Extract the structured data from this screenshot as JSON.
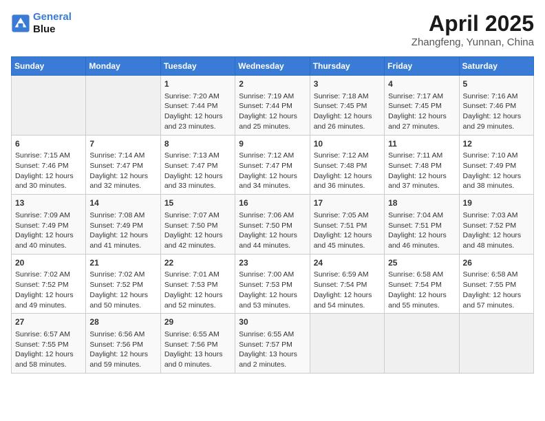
{
  "header": {
    "logo_line1": "General",
    "logo_line2": "Blue",
    "month_title": "April 2025",
    "location": "Zhangfeng, Yunnan, China"
  },
  "days_of_week": [
    "Sunday",
    "Monday",
    "Tuesday",
    "Wednesday",
    "Thursday",
    "Friday",
    "Saturday"
  ],
  "weeks": [
    [
      {
        "day": "",
        "content": ""
      },
      {
        "day": "",
        "content": ""
      },
      {
        "day": "1",
        "content": "Sunrise: 7:20 AM\nSunset: 7:44 PM\nDaylight: 12 hours and 23 minutes."
      },
      {
        "day": "2",
        "content": "Sunrise: 7:19 AM\nSunset: 7:44 PM\nDaylight: 12 hours and 25 minutes."
      },
      {
        "day": "3",
        "content": "Sunrise: 7:18 AM\nSunset: 7:45 PM\nDaylight: 12 hours and 26 minutes."
      },
      {
        "day": "4",
        "content": "Sunrise: 7:17 AM\nSunset: 7:45 PM\nDaylight: 12 hours and 27 minutes."
      },
      {
        "day": "5",
        "content": "Sunrise: 7:16 AM\nSunset: 7:46 PM\nDaylight: 12 hours and 29 minutes."
      }
    ],
    [
      {
        "day": "6",
        "content": "Sunrise: 7:15 AM\nSunset: 7:46 PM\nDaylight: 12 hours and 30 minutes."
      },
      {
        "day": "7",
        "content": "Sunrise: 7:14 AM\nSunset: 7:47 PM\nDaylight: 12 hours and 32 minutes."
      },
      {
        "day": "8",
        "content": "Sunrise: 7:13 AM\nSunset: 7:47 PM\nDaylight: 12 hours and 33 minutes."
      },
      {
        "day": "9",
        "content": "Sunrise: 7:12 AM\nSunset: 7:47 PM\nDaylight: 12 hours and 34 minutes."
      },
      {
        "day": "10",
        "content": "Sunrise: 7:12 AM\nSunset: 7:48 PM\nDaylight: 12 hours and 36 minutes."
      },
      {
        "day": "11",
        "content": "Sunrise: 7:11 AM\nSunset: 7:48 PM\nDaylight: 12 hours and 37 minutes."
      },
      {
        "day": "12",
        "content": "Sunrise: 7:10 AM\nSunset: 7:49 PM\nDaylight: 12 hours and 38 minutes."
      }
    ],
    [
      {
        "day": "13",
        "content": "Sunrise: 7:09 AM\nSunset: 7:49 PM\nDaylight: 12 hours and 40 minutes."
      },
      {
        "day": "14",
        "content": "Sunrise: 7:08 AM\nSunset: 7:49 PM\nDaylight: 12 hours and 41 minutes."
      },
      {
        "day": "15",
        "content": "Sunrise: 7:07 AM\nSunset: 7:50 PM\nDaylight: 12 hours and 42 minutes."
      },
      {
        "day": "16",
        "content": "Sunrise: 7:06 AM\nSunset: 7:50 PM\nDaylight: 12 hours and 44 minutes."
      },
      {
        "day": "17",
        "content": "Sunrise: 7:05 AM\nSunset: 7:51 PM\nDaylight: 12 hours and 45 minutes."
      },
      {
        "day": "18",
        "content": "Sunrise: 7:04 AM\nSunset: 7:51 PM\nDaylight: 12 hours and 46 minutes."
      },
      {
        "day": "19",
        "content": "Sunrise: 7:03 AM\nSunset: 7:52 PM\nDaylight: 12 hours and 48 minutes."
      }
    ],
    [
      {
        "day": "20",
        "content": "Sunrise: 7:02 AM\nSunset: 7:52 PM\nDaylight: 12 hours and 49 minutes."
      },
      {
        "day": "21",
        "content": "Sunrise: 7:02 AM\nSunset: 7:52 PM\nDaylight: 12 hours and 50 minutes."
      },
      {
        "day": "22",
        "content": "Sunrise: 7:01 AM\nSunset: 7:53 PM\nDaylight: 12 hours and 52 minutes."
      },
      {
        "day": "23",
        "content": "Sunrise: 7:00 AM\nSunset: 7:53 PM\nDaylight: 12 hours and 53 minutes."
      },
      {
        "day": "24",
        "content": "Sunrise: 6:59 AM\nSunset: 7:54 PM\nDaylight: 12 hours and 54 minutes."
      },
      {
        "day": "25",
        "content": "Sunrise: 6:58 AM\nSunset: 7:54 PM\nDaylight: 12 hours and 55 minutes."
      },
      {
        "day": "26",
        "content": "Sunrise: 6:58 AM\nSunset: 7:55 PM\nDaylight: 12 hours and 57 minutes."
      }
    ],
    [
      {
        "day": "27",
        "content": "Sunrise: 6:57 AM\nSunset: 7:55 PM\nDaylight: 12 hours and 58 minutes."
      },
      {
        "day": "28",
        "content": "Sunrise: 6:56 AM\nSunset: 7:56 PM\nDaylight: 12 hours and 59 minutes."
      },
      {
        "day": "29",
        "content": "Sunrise: 6:55 AM\nSunset: 7:56 PM\nDaylight: 13 hours and 0 minutes."
      },
      {
        "day": "30",
        "content": "Sunrise: 6:55 AM\nSunset: 7:57 PM\nDaylight: 13 hours and 2 minutes."
      },
      {
        "day": "",
        "content": ""
      },
      {
        "day": "",
        "content": ""
      },
      {
        "day": "",
        "content": ""
      }
    ]
  ]
}
